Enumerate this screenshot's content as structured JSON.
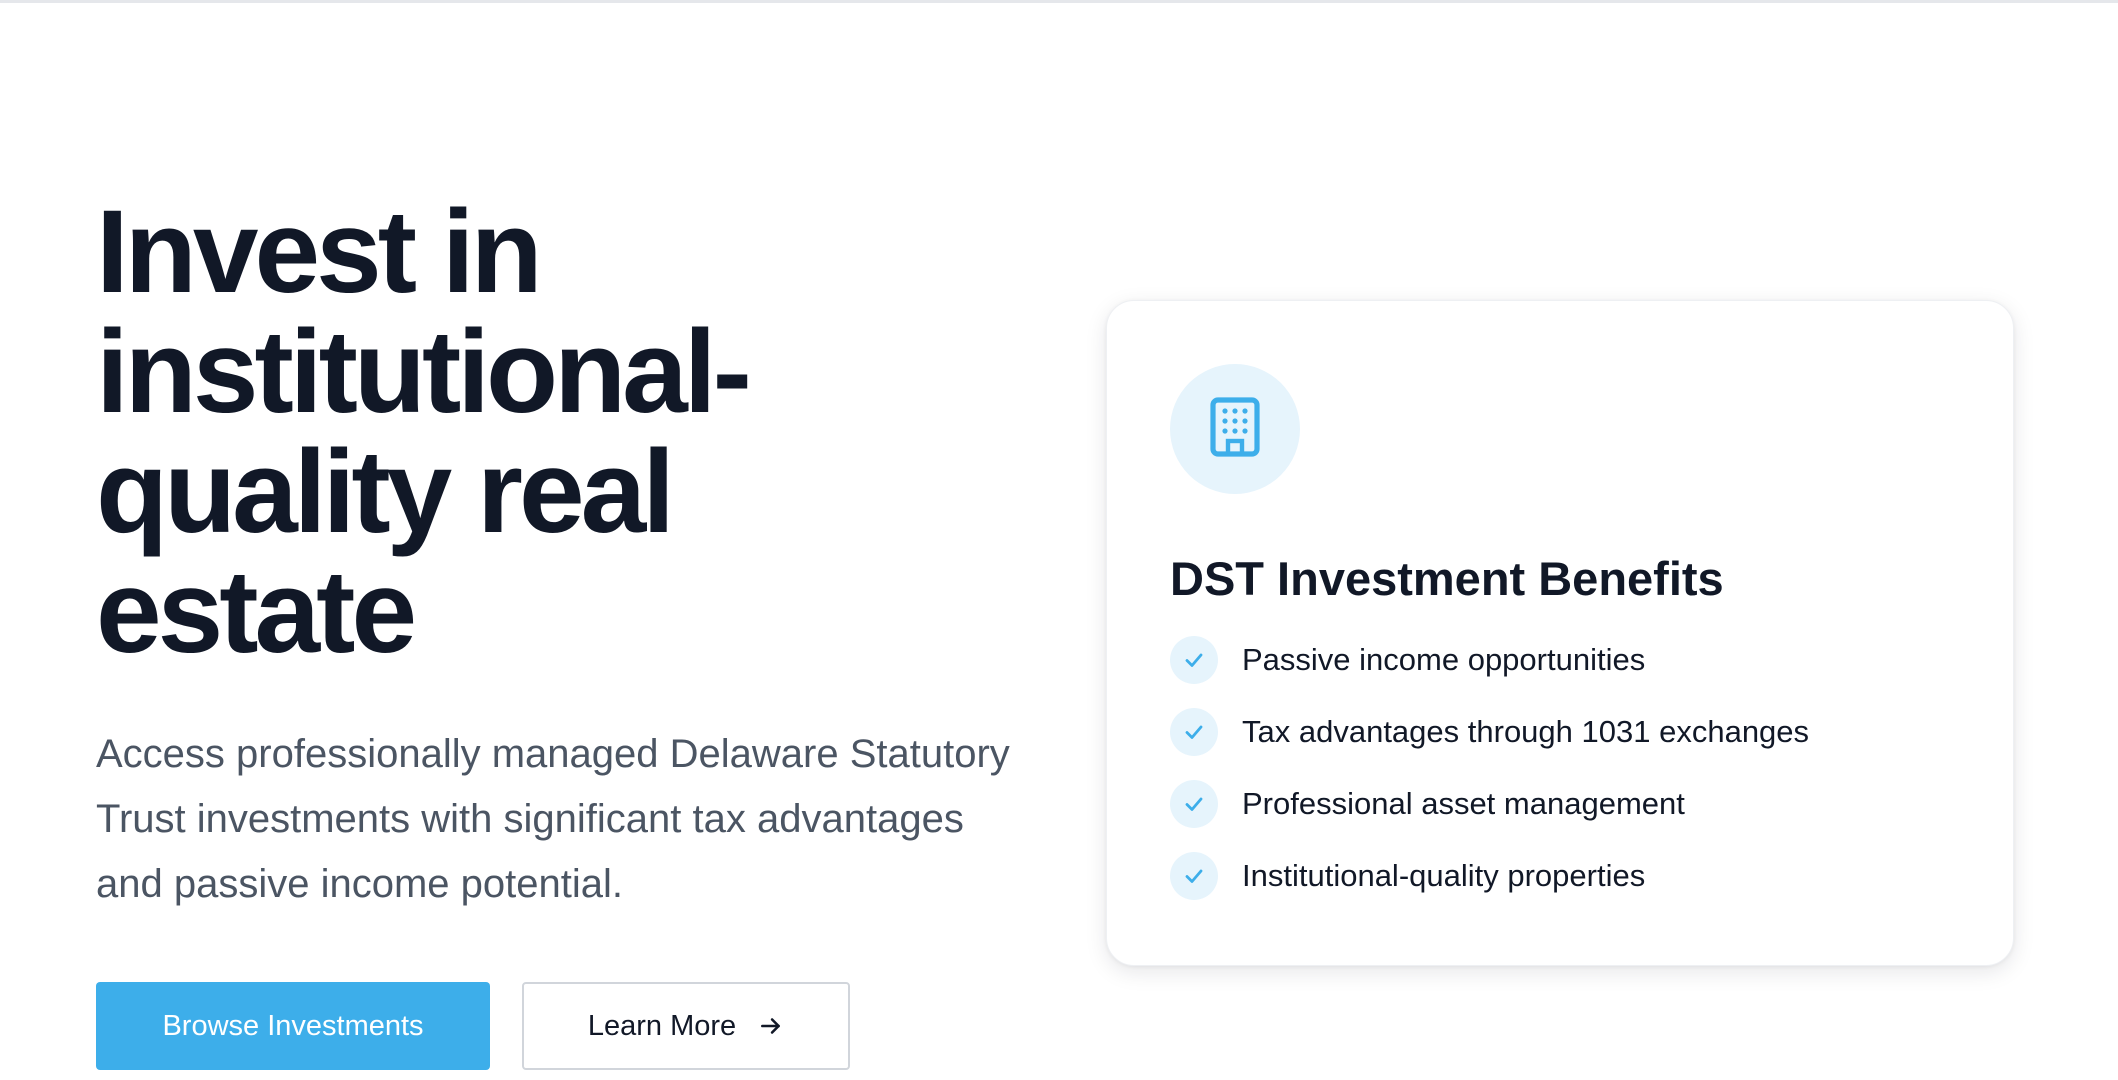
{
  "hero": {
    "title_lines": [
      "Invest in",
      "institutional-",
      "quality real",
      "estate"
    ],
    "subtitle_lines": [
      "Access professionally managed Delaware Statutory",
      "Trust investments with significant tax advantages",
      "and passive income potential."
    ],
    "primary_button": "Browse Investments",
    "secondary_button": "Learn More",
    "secondary_button_icon": "arrow-right-icon"
  },
  "card": {
    "icon": "building-icon",
    "title": "DST Investment Benefits",
    "benefits": [
      "Passive income opportunities",
      "Tax advantages through 1031 exchanges",
      "Professional asset management",
      "Institutional-quality properties"
    ],
    "benefit_icon": "check-icon"
  },
  "colors": {
    "accent": "#3daeea",
    "accent_light": "#e6f4fc",
    "heading": "#111827",
    "body_text": "#4b5563"
  }
}
